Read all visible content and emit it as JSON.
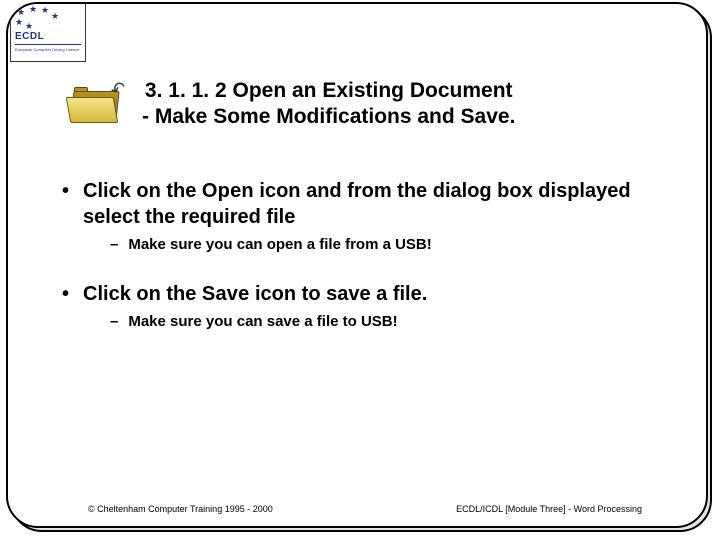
{
  "logo": {
    "label": "ECDL",
    "caption": "European Computer Driving Licence"
  },
  "title": {
    "line1": "3. 1. 1. 2 Open an Existing Document",
    "line2": "- Make Some Modifications and Save."
  },
  "bullets": [
    {
      "text_prefix": "Click on the ",
      "strong": "Open",
      "text_suffix": " icon and from the dialog box displayed select the required file",
      "sub": "Make sure you can open a file from a USB!"
    },
    {
      "text_prefix": "Click on the ",
      "strong": "Save",
      "text_suffix": " icon to save a file.",
      "sub": "Make sure you can save a file to USB!"
    }
  ],
  "footer": {
    "left": "© Cheltenham Computer Training 1995 - 2000",
    "right": "ECDL/ICDL [Module Three]  - Word Processing"
  }
}
